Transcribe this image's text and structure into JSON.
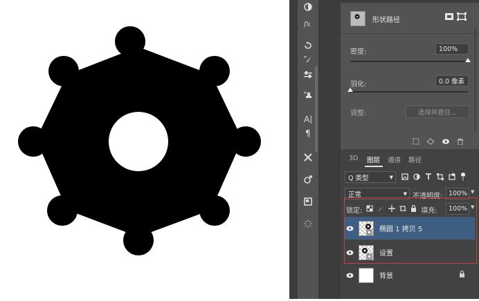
{
  "canvas": {
    "shape": "gear-shape"
  },
  "properties": {
    "layer_type_label": "形状路径",
    "density": {
      "label": "密度:",
      "value": "100%",
      "level": 1.0
    },
    "feather": {
      "label": "羽化:",
      "value": "0.0 像素",
      "level": 0.0
    },
    "refine": {
      "label": "调整:",
      "button": "选择并遮住..."
    }
  },
  "layers_panel": {
    "tabs": [
      "3D",
      "图层",
      "通道",
      "路径"
    ],
    "active_tab": "图层",
    "filter_label": "Q 类型",
    "blend_mode": "正常",
    "opacity_label": "不透明度:",
    "opacity_value": "100%",
    "lock_label": "锁定:",
    "fill_label": "填充:",
    "fill_value": "100%",
    "layers": [
      {
        "name": "椭圆 1 拷贝 5",
        "selected": true
      },
      {
        "name": "设置",
        "selected": false
      },
      {
        "name": "背景",
        "selected": false,
        "locked": true
      }
    ]
  },
  "colors": {
    "panel_bg": "#535353",
    "layer_selected": "#3f5f82",
    "highlight": "#d23b3b"
  }
}
